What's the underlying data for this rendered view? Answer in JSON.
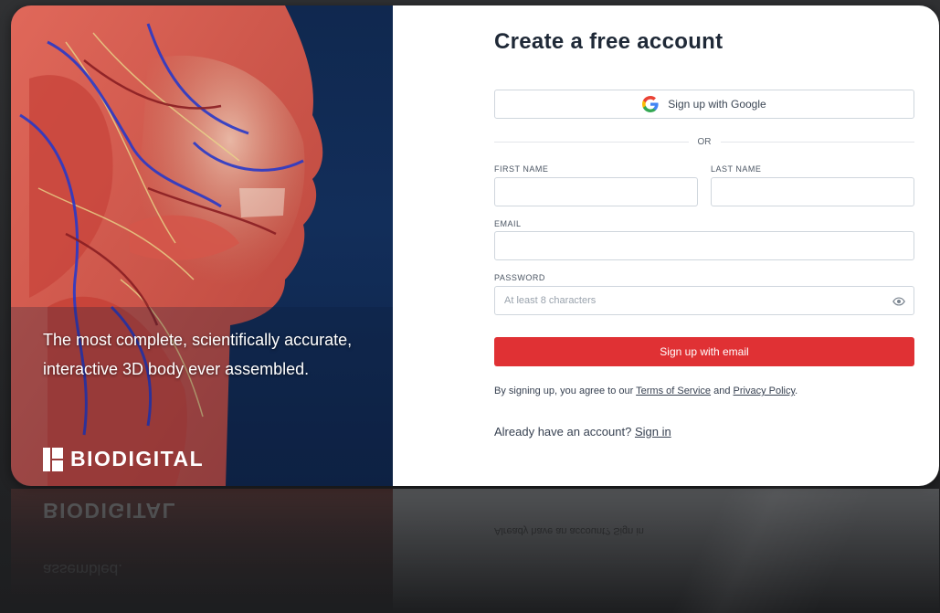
{
  "hero": {
    "tagline": "The most complete, scientifically accurate, interactive 3D body ever assembled.",
    "brand": "BIODIGITAL"
  },
  "form": {
    "title": "Create a free account",
    "google_button": "Sign up with Google",
    "divider": "OR",
    "first_name_label": "FIRST NAME",
    "last_name_label": "LAST NAME",
    "email_label": "EMAIL",
    "password_label": "PASSWORD",
    "password_placeholder": "At least 8 characters",
    "submit_button": "Sign up with email",
    "terms_prefix": "By signing up, you agree to our ",
    "terms_link": "Terms of Service",
    "terms_and": " and ",
    "privacy_link": "Privacy Policy",
    "terms_suffix": ".",
    "signin_prefix": "Already have an account? ",
    "signin_link": "Sign in"
  },
  "colors": {
    "accent_red": "#e03134",
    "hero_blue": "#122e5a"
  },
  "icons": {
    "google": "google-logo-icon",
    "eye": "eye-icon",
    "brand": "biodigital-logo-icon"
  }
}
